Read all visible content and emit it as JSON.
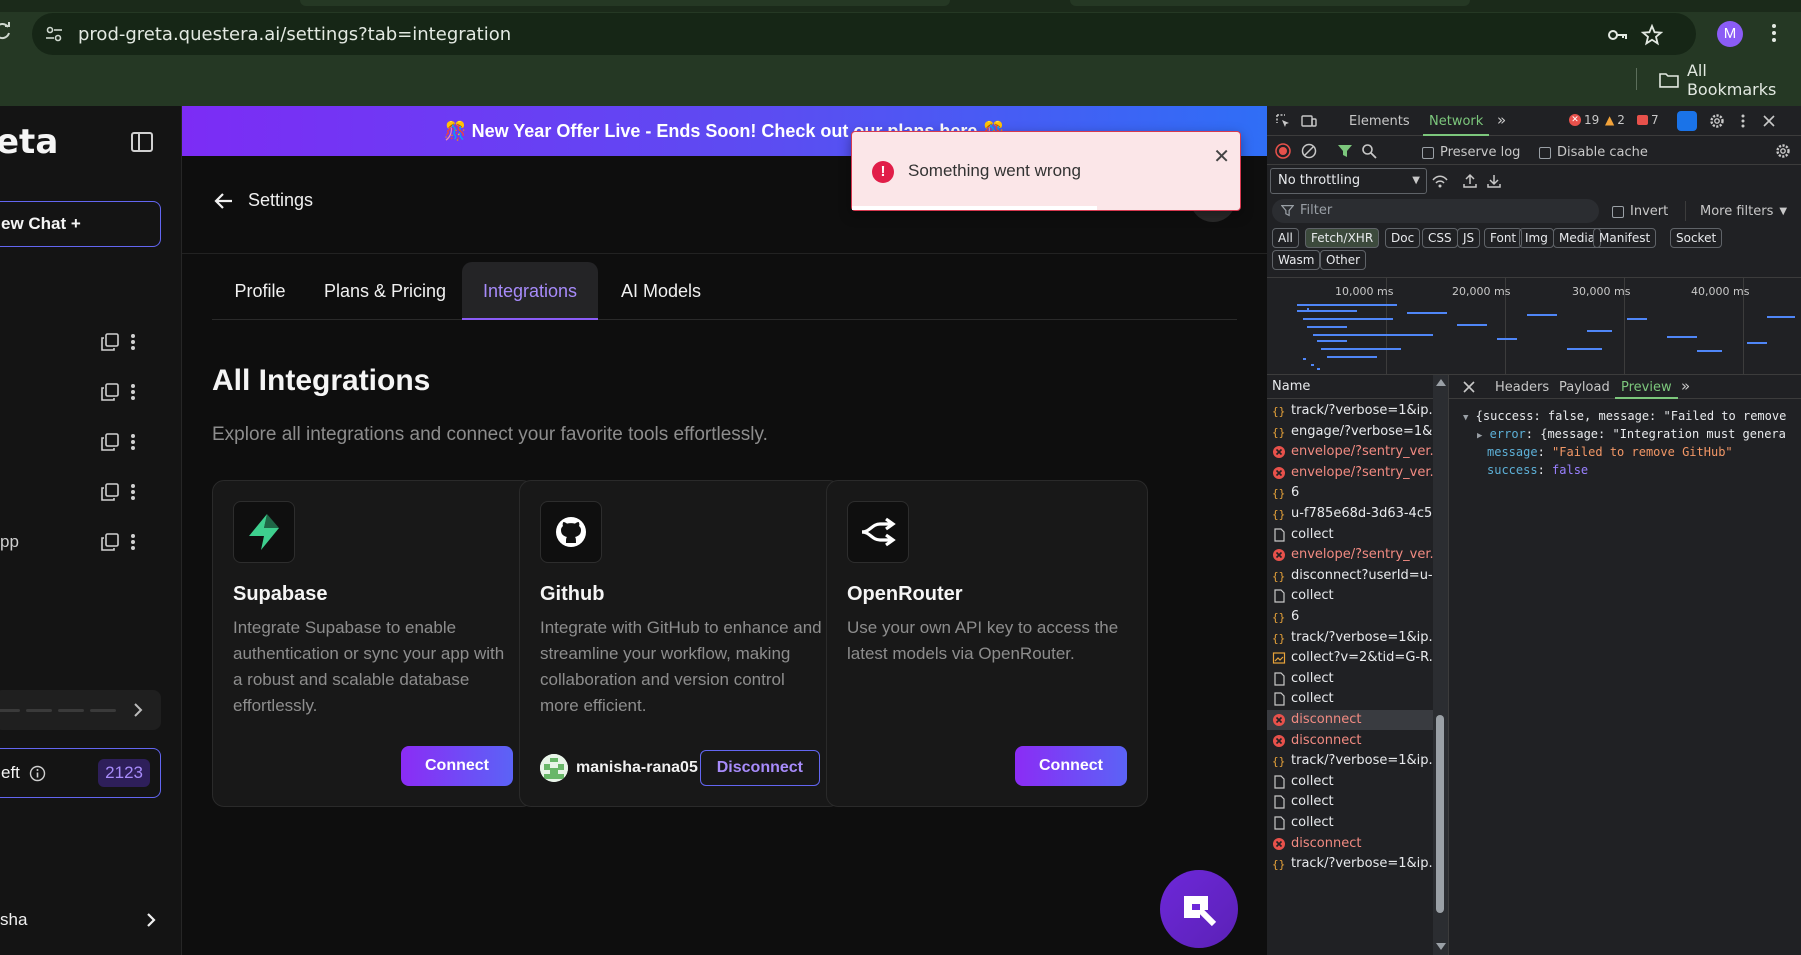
{
  "browser": {
    "url": "prod-greta.questera.ai/settings?tab=integration",
    "bookmarks_label": "All Bookmarks",
    "profile_initial": "M"
  },
  "sidebar": {
    "brand": "eta",
    "new_chat_label": "ew Chat +",
    "chats": [
      {
        "label": ""
      },
      {
        "label": ""
      },
      {
        "label": ""
      },
      {
        "label": ""
      },
      {
        "label": "pp"
      }
    ],
    "credits_label": "eft",
    "credits_count": "2123",
    "user_name": "sha"
  },
  "main": {
    "banner_text": "🎊 New Year Offer Live - Ends Soon! Check out our plans here 🎊",
    "back_label": "Settings",
    "tabs": [
      {
        "label": "Profile"
      },
      {
        "label": "Plans & Pricing"
      },
      {
        "label": "Integrations"
      },
      {
        "label": "AI Models"
      }
    ],
    "section_title": "All Integrations",
    "section_subtitle": "Explore all integrations and connect your favorite tools effortlessly.",
    "cards": [
      {
        "title": "Supabase",
        "description": "Integrate Supabase to enable authentication or sync your app with a robust and scalable database effortlessly.",
        "action": "Connect"
      },
      {
        "title": "Github",
        "description": "Integrate with GitHub to enhance and streamline your workflow, making collaboration and version control more efficient.",
        "action": "Disconnect",
        "connected_user": "manisha-rana05"
      },
      {
        "title": "OpenRouter",
        "description": "Use your own API key to access the latest models via OpenRouter.",
        "action": "Connect"
      }
    ]
  },
  "toast": {
    "message": "Something went wrong",
    "close": "✕"
  },
  "devtools": {
    "tabs": {
      "elements": "Elements",
      "network": "Network"
    },
    "counts": {
      "errors": "19",
      "warnings": "2",
      "issues": "7"
    },
    "preserve_log": "Preserve log",
    "disable_cache": "Disable cache",
    "throttling": "No throttling",
    "filter_placeholder": "Filter",
    "invert": "Invert",
    "more_filters": "More filters",
    "chips": [
      "All",
      "Fetch/XHR",
      "Doc",
      "CSS",
      "JS",
      "Font",
      "Img",
      "Media",
      "Manifest",
      "Socket",
      "Wasm",
      "Other"
    ],
    "timeline_labels": [
      "10,000 ms",
      "20,000 ms",
      "30,000 ms",
      "40,000 ms"
    ],
    "name_header": "Name",
    "detail_tabs": [
      "Headers",
      "Payload",
      "Preview"
    ],
    "requests": [
      {
        "name": "track/?verbose=1&ip...",
        "kind": "xhr",
        "error": false
      },
      {
        "name": "engage/?verbose=1&...",
        "kind": "xhr",
        "error": false
      },
      {
        "name": "envelope/?sentry_ver...",
        "kind": "err",
        "error": true
      },
      {
        "name": "envelope/?sentry_ver...",
        "kind": "err",
        "error": true
      },
      {
        "name": "6",
        "kind": "xhr",
        "error": false
      },
      {
        "name": "u-f785e68d-3d63-4c5...",
        "kind": "xhr",
        "error": false
      },
      {
        "name": "collect",
        "kind": "doc",
        "error": false
      },
      {
        "name": "envelope/?sentry_ver...",
        "kind": "err",
        "error": true
      },
      {
        "name": "disconnect?userId=u-...",
        "kind": "xhr",
        "error": false
      },
      {
        "name": "collect",
        "kind": "doc",
        "error": false
      },
      {
        "name": "6",
        "kind": "xhr",
        "error": false
      },
      {
        "name": "track/?verbose=1&ip...",
        "kind": "xhr",
        "error": false
      },
      {
        "name": "collect?v=2&tid=G-R...",
        "kind": "img",
        "error": false
      },
      {
        "name": "collect",
        "kind": "doc",
        "error": false
      },
      {
        "name": "collect",
        "kind": "doc",
        "error": false
      },
      {
        "name": "disconnect",
        "kind": "err",
        "error": true
      },
      {
        "name": "disconnect",
        "kind": "err",
        "error": true
      },
      {
        "name": "track/?verbose=1&ip...",
        "kind": "xhr",
        "error": false
      },
      {
        "name": "collect",
        "kind": "doc",
        "error": false
      },
      {
        "name": "collect",
        "kind": "doc",
        "error": false
      },
      {
        "name": "collect",
        "kind": "doc",
        "error": false
      },
      {
        "name": "disconnect",
        "kind": "err",
        "error": true
      },
      {
        "name": "track/?verbose=1&ip...",
        "kind": "xhr",
        "error": false
      }
    ],
    "preview": {
      "line1": "{success: false, message: \"Failed to remove",
      "error_key": "error",
      "error_val": "{message: \"Integration must genera",
      "message_key": "message",
      "message_val": "\"Failed to remove GitHub\"",
      "success_key": "success",
      "success_val": "false"
    }
  }
}
